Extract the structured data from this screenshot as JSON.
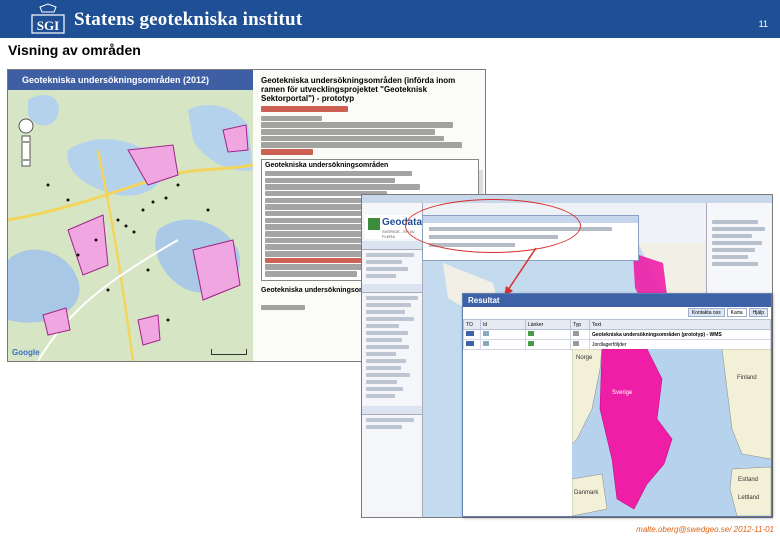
{
  "header": {
    "brand": "Statens geotekniska institut",
    "slide_number": "11",
    "logo_text": "SGI"
  },
  "slide": {
    "title": "Visning av områden",
    "footer": "malte.oberg@swedgeo.se/ 2012-11-01"
  },
  "shot1": {
    "map_title": "Geotekniska undersökningsområden (2012)",
    "info_heading_1": "Geotekniska undersökningsområden (införda inom ramen för utvecklingsprojektet \"Geoteknisk Sektorportal\") - prototyp",
    "info_link": "Nedladdning",
    "info_heading_2": "Geotekniska undersökningsområden",
    "google": "Google",
    "footer_link": "Visa större karta"
  },
  "shot2": {
    "brand": "Geodata",
    "brand_sub": "SVERIGE - EN AV FLERA",
    "result": {
      "title": "Resultat",
      "tabs": [
        "Kontakta oss",
        "Karta",
        "Hjälp"
      ],
      "columns": [
        "TO",
        "Id",
        "Länker",
        "Typ",
        "Text"
      ],
      "rows": [
        {
          "text": "Geotekniska undersökningsområden (prototyp) - WMS"
        },
        {
          "text": "Jordlagerföljder"
        }
      ],
      "map_labels": [
        "Norge",
        "Sverige",
        "Finland",
        "Estland",
        "Lettland",
        "Danmark"
      ]
    }
  },
  "colors": {
    "header_blue": "#1f4f94",
    "highlight_pink": "#ee1fa6",
    "annotation_red": "#d9302c",
    "footer_orange": "#e06010"
  }
}
